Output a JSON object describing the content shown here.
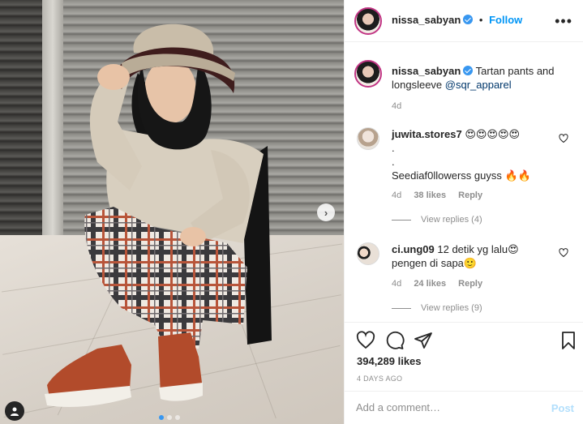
{
  "post": {
    "username": "nissa_sabyan",
    "separator": "•",
    "follow_label": "Follow",
    "more_label": "•••",
    "caption_text": "Tartan pants and longsleeve",
    "caption_mention": "@sqr_apparel",
    "caption_age": "4d",
    "carousel": {
      "slide_count": 3,
      "active_slide": 1
    }
  },
  "comments": [
    {
      "username": "juwita.stores7",
      "line1": "😍😍😍😍😍",
      "line2": ".",
      "line3": ".",
      "line4": "Seediaf0llowerss guyss 🔥🔥",
      "age": "4d",
      "likes": "38 likes",
      "reply_label": "Reply",
      "view_replies": "View replies (4)"
    },
    {
      "username": "ci.ung09",
      "line1": "12 detik yg lalu😍",
      "line2": "pengen di sapa🙂",
      "age": "4d",
      "likes": "24 likes",
      "reply_label": "Reply",
      "view_replies": "View replies (9)"
    }
  ],
  "actions": {
    "like_count": "394,289 likes",
    "date": "4 DAYS AGO",
    "comment_placeholder": "Add a comment…",
    "post_label": "Post"
  },
  "colors": {
    "accent": "#0095f6",
    "verified": "#3897f0",
    "post_disabled": "#b2dffc",
    "muted": "#8e8e8e",
    "text": "#262626"
  },
  "icons": [
    "heart-icon",
    "comment-icon",
    "share-icon",
    "bookmark-icon",
    "chevron-right-icon",
    "user-tag-icon",
    "verified-badge-icon",
    "more-options-icon"
  ]
}
